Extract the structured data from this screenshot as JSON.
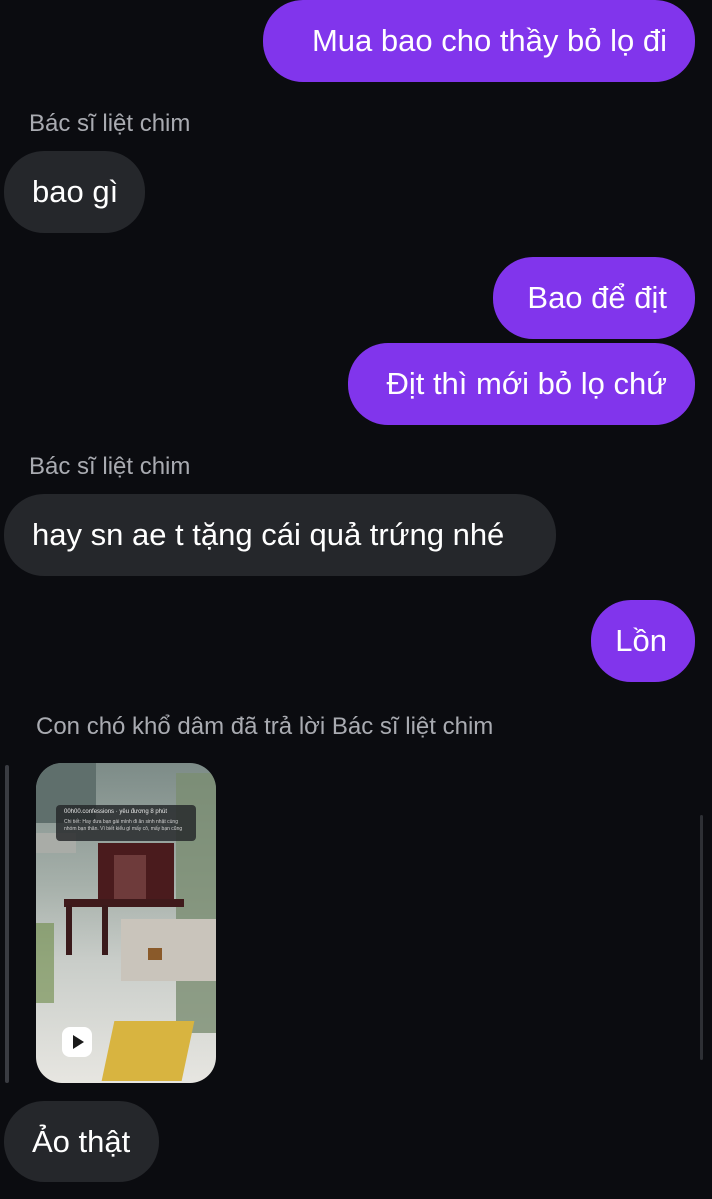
{
  "messages": {
    "m1": "Mua bao cho thầy bỏ lọ đi",
    "sender1": "Bác sĩ liệt chim",
    "m2": "bao gì",
    "m3": "Bao để địt",
    "m4": "Địt thì mới bỏ lọ chứ",
    "sender2": "Bác sĩ liệt chim",
    "m5": "hay sn ae t tặng cái quả trứng nhé",
    "m6": "Lồn",
    "reply_label": "Con chó khổ dâm đã trả lời Bác sĩ liệt chim",
    "m7": "Ảo thật"
  },
  "thumbnail": {
    "post_title": "00h00.confessions · yêu đương 8 phút",
    "post_text": "Chi tiết: Hay đưa bạn gái mình đi ăn sinh nhật cùng nhóm bạn thân. Vì biết kiểu gì mấy cô, mấy bạn cũng",
    "play_icon": "play-icon"
  },
  "colors": {
    "background": "#0b0c10",
    "outgoing_bubble": "#8135ec",
    "incoming_bubble": "#25272b",
    "sender_text": "#a9abb1"
  }
}
